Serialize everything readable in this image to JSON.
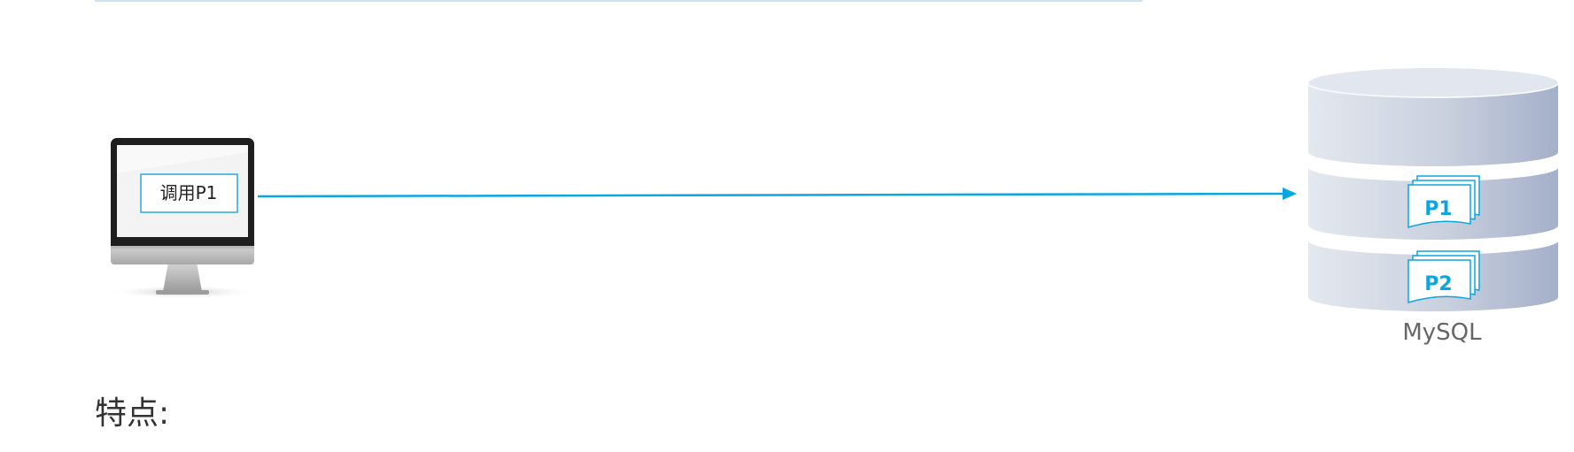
{
  "diagram": {
    "client": {
      "button_label": "调用P1",
      "icon": "monitor-icon"
    },
    "arrow": {
      "direction": "client-to-database",
      "color": "#0aa6e0"
    },
    "database": {
      "name": "MySQL",
      "icon": "database-cylinder-icon",
      "procedures": [
        "P1",
        "P2"
      ],
      "accent": "#0aa6e0"
    }
  },
  "section": {
    "heading": "特点:"
  }
}
